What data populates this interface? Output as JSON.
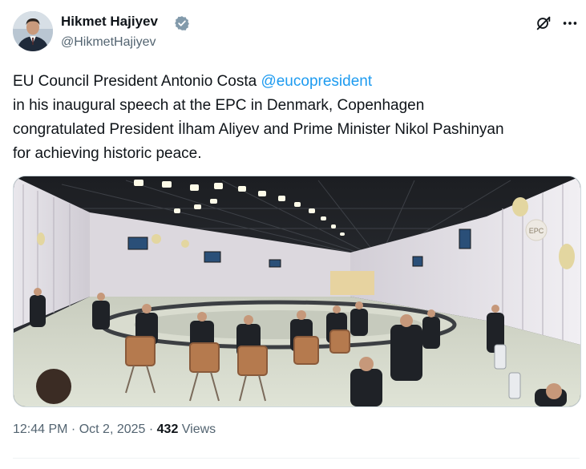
{
  "author": {
    "name": "Hikmet Hajiyev",
    "handle": "@HikmetHajiyev",
    "verified": true,
    "avatar_icon": "profile-photo"
  },
  "actions": {
    "grok_icon": "grok-icon",
    "more_icon": "more-options-icon"
  },
  "tweet": {
    "line1_prefix": "EU Council President Antonio Costa ",
    "mention": "@eucopresident",
    "line2": "in his inaugural speech at the EPC in Denmark, Copenhagen",
    "line3": "congratulated President İlham Aliyev and Prime Minister Nikol Pashinyan",
    "line4": "for achieving historic peace."
  },
  "media": {
    "badge_text": "EPC"
  },
  "meta": {
    "time": "12:44 PM",
    "separator": " · ",
    "date": "Oct 2, 2025",
    "views_count": "432",
    "views_label": " Views"
  },
  "colors": {
    "accent": "#1d9bf0",
    "text": "#0f1419",
    "muted": "#536471",
    "verified": "#829aab"
  }
}
